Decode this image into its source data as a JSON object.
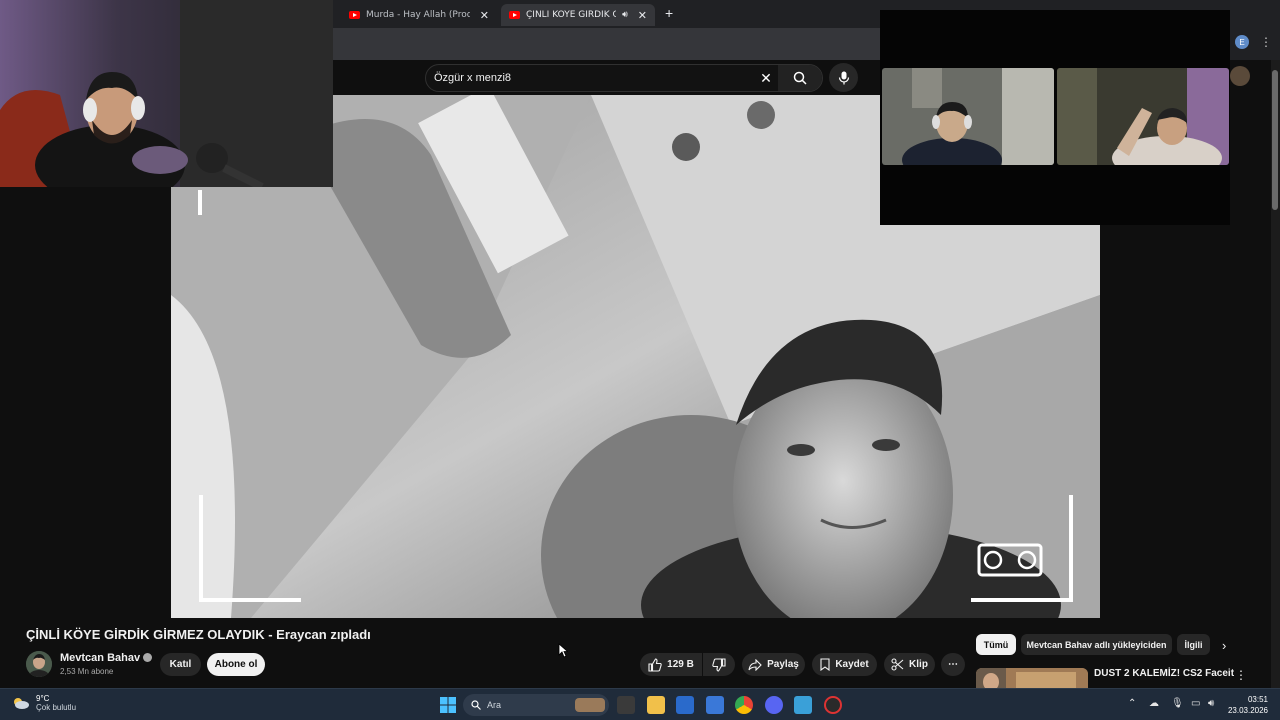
{
  "browser": {
    "tabs": [
      {
        "title": "Murda - Hay Allah (Prod. Vlado",
        "active": false
      },
      {
        "title": "ÇİNLİ KÖYE GİRDİK GİRME",
        "active": true
      }
    ],
    "new_tab_icon": "plus-icon"
  },
  "search": {
    "query": "Özgür x menzi8",
    "clear_icon": "close-icon",
    "search_icon": "search-icon",
    "mic_icon": "mic-icon"
  },
  "profile": {
    "initial": "E"
  },
  "video": {
    "title": "ÇİNLİ KÖYE GİRDİK GİRMEZ OLAYDIK - Eraycan zıpladı"
  },
  "channel": {
    "name": "Mevtcan Bahav",
    "subscribers": "2,53 Mn abone",
    "join_label": "Katıl",
    "subscribe_label": "Abone ol"
  },
  "actions": {
    "likes": "129 B",
    "share": "Paylaş",
    "save": "Kaydet",
    "clip": "Klip"
  },
  "chips": [
    "Tümü",
    "Mevtcan Bahav adlı yükleyiciden",
    "İlgili"
  ],
  "related": {
    "first_title": "DUST 2 KALEMİZ! CS2 Faceit"
  },
  "taskbar": {
    "temperature": "9°C",
    "condition": "Çok bulutlu",
    "search_placeholder": "Ara",
    "time": "03:51",
    "date": "23.03.2026"
  },
  "colors": {
    "background": "#0f0f0f",
    "pill": "#272727",
    "subscribe_bg": "#f1f1f1",
    "taskbar": "#1f2b3a",
    "yt_red": "#ff0000"
  }
}
